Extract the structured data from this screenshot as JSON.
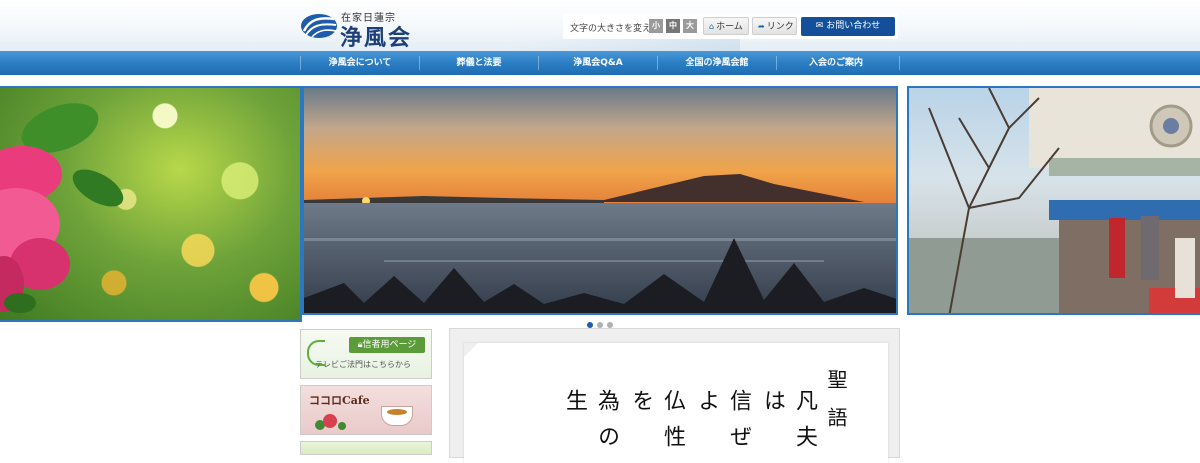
{
  "header": {
    "logo_sub": "在家日蓮宗",
    "logo_main": "浄風会",
    "font_size_label": "文字の大きさを変える",
    "font_sizes": [
      "小",
      "中",
      "大"
    ],
    "home_label": "ホーム",
    "link_label": "リンク",
    "contact_label": "お問い合わせ",
    "icons": {
      "logo": "wave-logo-icon",
      "home": "home-icon",
      "link": "arrow-icon",
      "contact": "mail-icon"
    }
  },
  "nav": {
    "items": [
      "浄風会について",
      "葬儀と法要",
      "浄風会Q&A",
      "全国の浄風会館",
      "入会のご案内"
    ]
  },
  "slider": {
    "slides": [
      "flower-bokeh",
      "mountain-sunrise",
      "temple-entrance"
    ],
    "active_index": 0
  },
  "sidebar": {
    "believer_badge": "信者用ページ",
    "believer_sub": "テレビご法門はこちらから",
    "cafe_title": "ココロCafe"
  },
  "verse": {
    "title": "聖語",
    "columns": [
      "凡夫は",
      "信ぜよ",
      "仏性を",
      "為の生"
    ]
  },
  "colors": {
    "accent": "#1f6db2",
    "brand_dark": "#144f9a",
    "green": "#5c9b3a"
  }
}
